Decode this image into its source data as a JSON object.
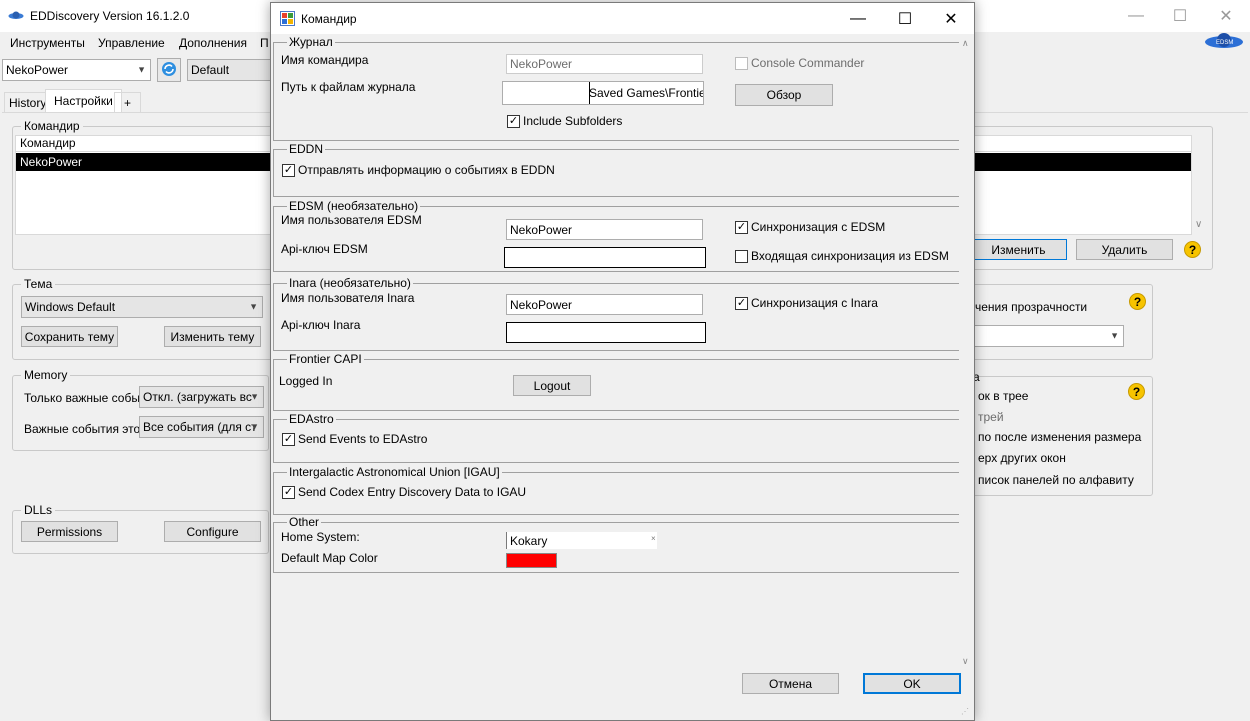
{
  "main": {
    "title": "EDDiscovery Version 16.1.2.0",
    "menu": [
      "Инструменты",
      "Управление",
      "Дополнения",
      "П"
    ],
    "commander_select": "NekoPower",
    "profile_select": "Default",
    "tabs": [
      "History",
      "Настройки",
      "+"
    ],
    "commanders_group": {
      "label": "Командир",
      "column_header": "Командир",
      "rows": [
        "NekoPower"
      ],
      "edit_button": "Изменить",
      "delete_button": "Удалить"
    },
    "theme_group": {
      "label": "Тема",
      "theme_select": "Windows Default",
      "save_button": "Сохранить тему",
      "edit_button": "Изменить тему"
    },
    "transparency_label": "чения прозрачности",
    "memory_group": {
      "label": "Memory",
      "row1_label": "Только важные событ",
      "row1_value": "Откл. (загружать вс",
      "row2_label": "Важные события это",
      "row2_value": "Все события (для ст"
    },
    "window_group": {
      "label_partial": "а",
      "options": [
        "ок в трее",
        "трей",
        "по после изменения размера",
        "ерх других окон",
        "писок панелей по алфавиту"
      ]
    },
    "dlls_group": {
      "label": "DLLs",
      "permissions_button": "Permissions",
      "configure_button": "Configure"
    }
  },
  "dialog": {
    "title": "Командир",
    "journal": {
      "label": "Журнал",
      "commander_name_label": "Имя командира",
      "commander_name_value": "NekoPower",
      "console_commander": "Console Commander",
      "path_label": "Путь к файлам журнала",
      "path_value": "Saved Games\\Frontier D",
      "browse_button": "Обзор",
      "include_subfolders": "Include Subfolders"
    },
    "eddn": {
      "label": "EDDN",
      "send_events": "Отправлять информацию о событиях в EDDN"
    },
    "edsm": {
      "label": "EDSM (необязательно)",
      "username_label": "Имя пользователя EDSM",
      "username_value": "NekoPower",
      "apikey_label": "Api-ключ EDSM",
      "apikey_value": "",
      "sync_label": "Синхронизация с EDSM",
      "incoming_sync_label": "Входящая синхронизация из EDSM"
    },
    "inara": {
      "label": "Inara (необязательно)",
      "username_label": "Имя пользователя Inara",
      "username_value": "NekoPower",
      "apikey_label": "Api-ключ Inara",
      "apikey_value": "",
      "sync_label": "Синхронизация с Inara"
    },
    "capi": {
      "label": "Frontier CAPI",
      "status": "Logged In",
      "logout_button": "Logout"
    },
    "edastro": {
      "label": "EDAstro",
      "send_events": "Send Events to EDAstro"
    },
    "igau": {
      "label": "Intergalactic Astronomical Union [IGAU]",
      "send_codex": "Send Codex Entry Discovery Data to IGAU"
    },
    "other": {
      "label": "Other",
      "home_system_label": "Home System:",
      "home_system_value": "Kokary",
      "map_color_label": "Default Map Color"
    },
    "cancel_button": "Отмена",
    "ok_button": "OK"
  },
  "colors": {
    "map_color": "#ff0000",
    "selection": "#000000",
    "accent": "#0078d7"
  }
}
